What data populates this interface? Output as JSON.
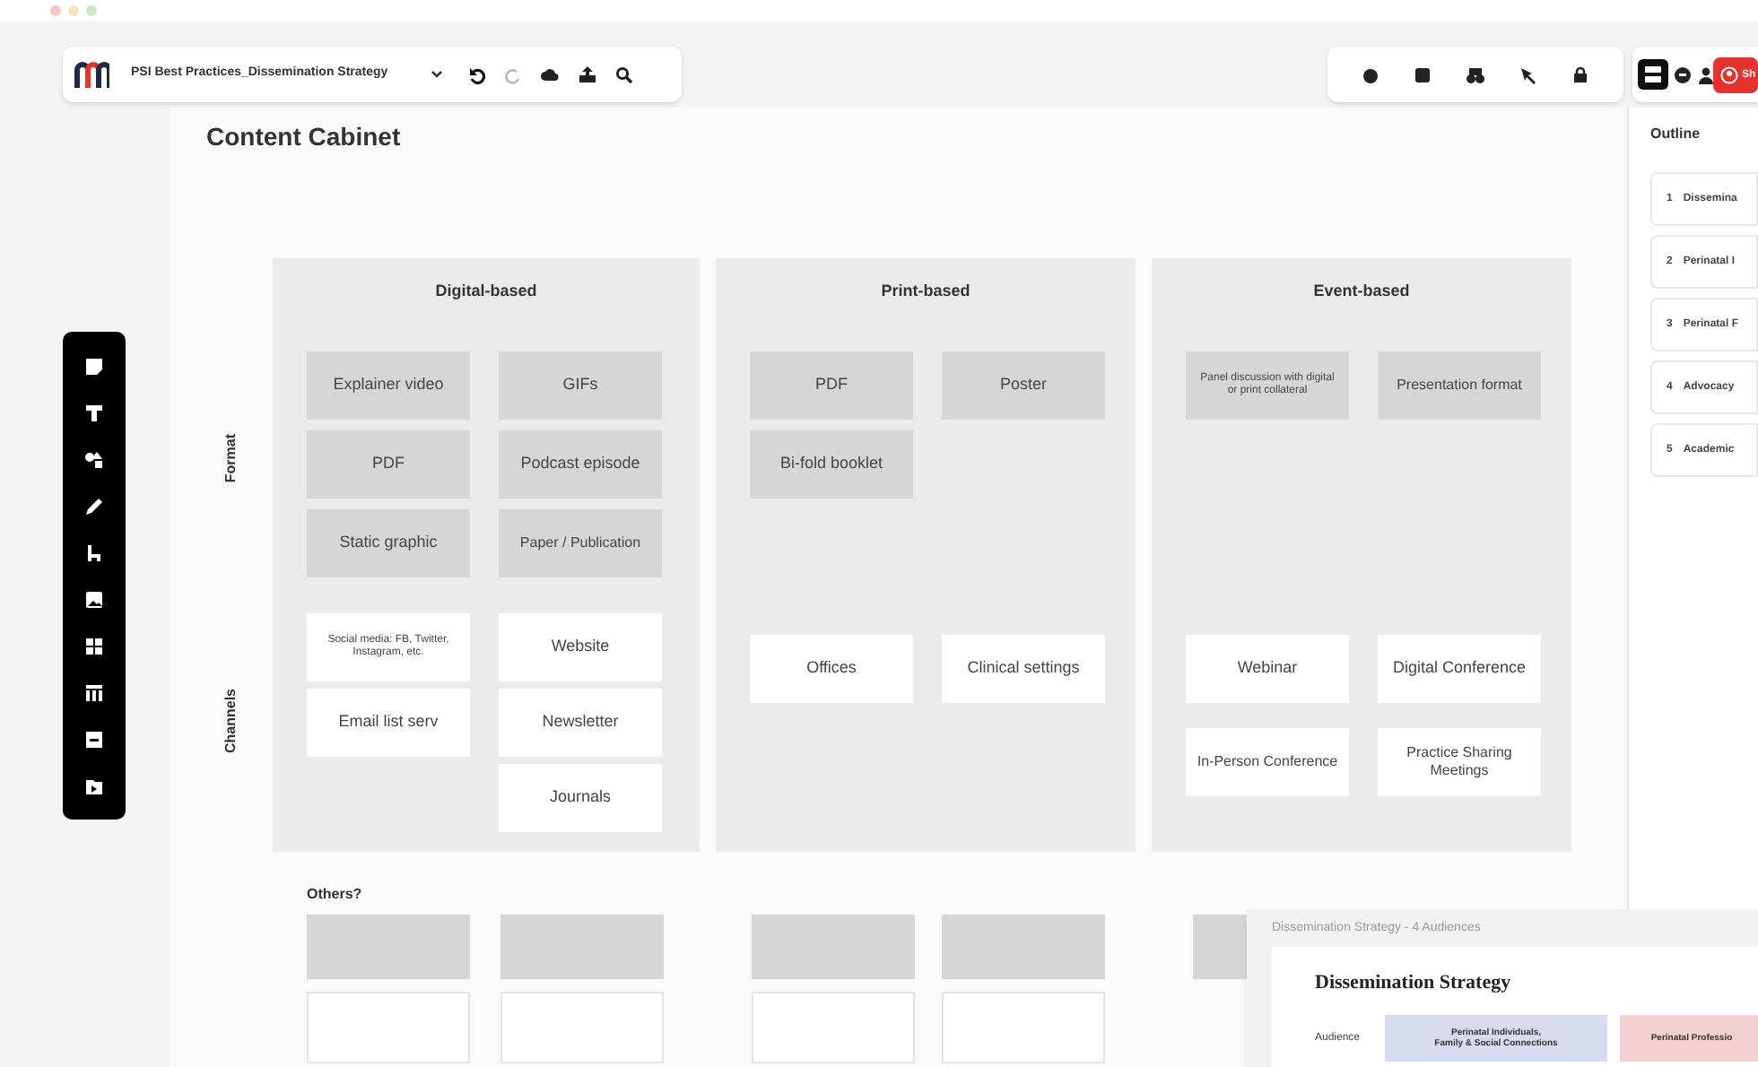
{
  "toolbar": {
    "board_title": "PSI Best Practices_Dissemination Strategy",
    "share_label": "Sh"
  },
  "frame": {
    "title": "Content Cabinet"
  },
  "board": {
    "columns": [
      "Digital-based",
      "Print-based",
      "Event-based"
    ],
    "rows": [
      {
        "label": "Format",
        "kind": "grey",
        "cells": [
          [
            "Explainer video",
            "GIFs",
            "PDF",
            "Podcast episode",
            "Static graphic",
            "Paper / Publication"
          ],
          [
            "PDF",
            "Poster",
            "Bi-fold booklet"
          ],
          [
            "Panel discussion with digital or print collateral",
            "Presentation format"
          ]
        ]
      },
      {
        "label": "Channels",
        "kind": "white",
        "cells": [
          [
            "Social media: FB, Twitter, Instagram, etc.",
            "Website",
            "Email list serv",
            "Newsletter",
            "",
            "Journals"
          ],
          [
            "Offices",
            "Clinical settings"
          ],
          [
            "Webinar",
            "Digital Conference",
            "In-Person Conference",
            "Practice Sharing Meetings"
          ]
        ]
      }
    ],
    "others_label": "Others?"
  },
  "outline": {
    "title": "Outline",
    "items": [
      {
        "number": "1",
        "label": "Dissemina"
      },
      {
        "number": "2",
        "label": "Perinatal I"
      },
      {
        "number": "3",
        "label": "Perinatal F"
      },
      {
        "number": "4",
        "label": "Advocacy"
      },
      {
        "number": "5",
        "label": "Academic"
      }
    ]
  },
  "preview": {
    "caption": "Dissemination Strategy - 4 Audiences",
    "title": "Dissemination Strategy",
    "row_label": "Audience",
    "audiences": [
      {
        "label": "Perinatal Individuals,\nFamily & Social Connections",
        "color": "#d8dbef"
      },
      {
        "label": "Perinatal Professio",
        "color": "#f1d0cf"
      }
    ]
  }
}
